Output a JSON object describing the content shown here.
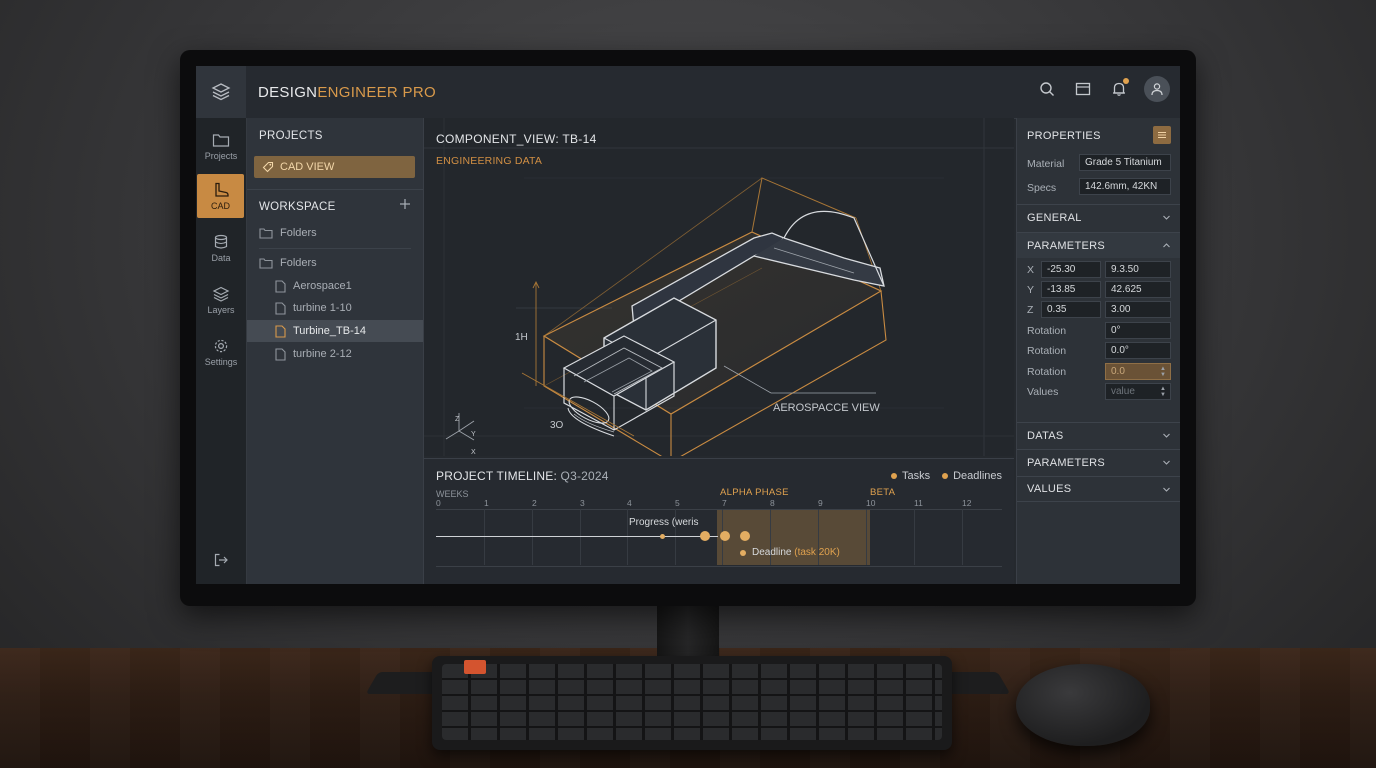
{
  "app": {
    "title_part1": "DESIGN",
    "title_part2": "ENGINEER PRO"
  },
  "topbar_icons": [
    "search-icon",
    "calendar-icon",
    "bell-icon",
    "user-icon"
  ],
  "rail": {
    "items": [
      {
        "label": "Projects",
        "icon": "folder-icon"
      },
      {
        "label": "CAD",
        "icon": "boot-icon"
      },
      {
        "label": "Data",
        "icon": "database-icon"
      },
      {
        "label": "Layers",
        "icon": "layers-icon"
      },
      {
        "label": "Settings",
        "icon": "gear-icon"
      }
    ]
  },
  "sidebar": {
    "projects_heading": "PROJECTS",
    "cad_view_label": "CAD VIEW",
    "workspace_heading": "WORKSPACE",
    "tree": [
      {
        "label": "Folders",
        "type": "folder"
      },
      {
        "label": "Folders",
        "type": "folder"
      },
      {
        "label": "Aerospace1",
        "type": "file"
      },
      {
        "label": "turbine 1-10",
        "type": "file"
      },
      {
        "label": "Turbine_TB-14",
        "type": "file",
        "selected": true
      },
      {
        "label": "turbine 2-12",
        "type": "file"
      }
    ]
  },
  "viewport": {
    "title": "COMPONENT_VIEW: TB-14",
    "subtitle": "ENGINEERING DATA",
    "dim_height": "1H",
    "dim_depth": "3O",
    "callout": "AEROSPACCE VIEW",
    "axes": {
      "z": "Z",
      "y": "Y",
      "x": "X"
    }
  },
  "timeline": {
    "title": "PROJECT TIMELINE:",
    "period": "Q3-2024",
    "legend": [
      "Tasks",
      "Deadlines"
    ],
    "weeks_label": "WEEKS",
    "ticks": [
      "0",
      "1",
      "2",
      "3",
      "4",
      "5",
      "7",
      "8",
      "9",
      "10",
      "11",
      "12"
    ],
    "phase_alpha": "ALPHA PHASE",
    "phase_beta": "BETA",
    "progress_label": "Progress (weris",
    "deadline_label": "Deadline",
    "deadline_task": "(task 20K)"
  },
  "properties": {
    "heading": "PROPERTIES",
    "material_label": "Material",
    "material_value": "Grade 5 Titanium",
    "specs_label": "Specs",
    "specs_value": "142.6mm, 42KN",
    "general": "GENERAL",
    "parameters": "PARAMETERS",
    "x_label": "X",
    "x1": "-25.30",
    "x2": "9.3.50",
    "y_label": "Y",
    "y1": "-13.85",
    "y2": "42.625",
    "z_label": "Z",
    "z1": "0.35",
    "z2": "3.00",
    "rotation_label": "Rotation",
    "rotation1": "0°",
    "rotation2": "0.0°",
    "rotation3": "0.0",
    "values_label": "Values",
    "values_placeholder": "value",
    "datas": "DATAS",
    "parameters2": "PARAMETERS",
    "values": "VALUES"
  },
  "colors": {
    "accent": "#d99a4b",
    "panel": "#2f343b",
    "background": "#25292e"
  }
}
